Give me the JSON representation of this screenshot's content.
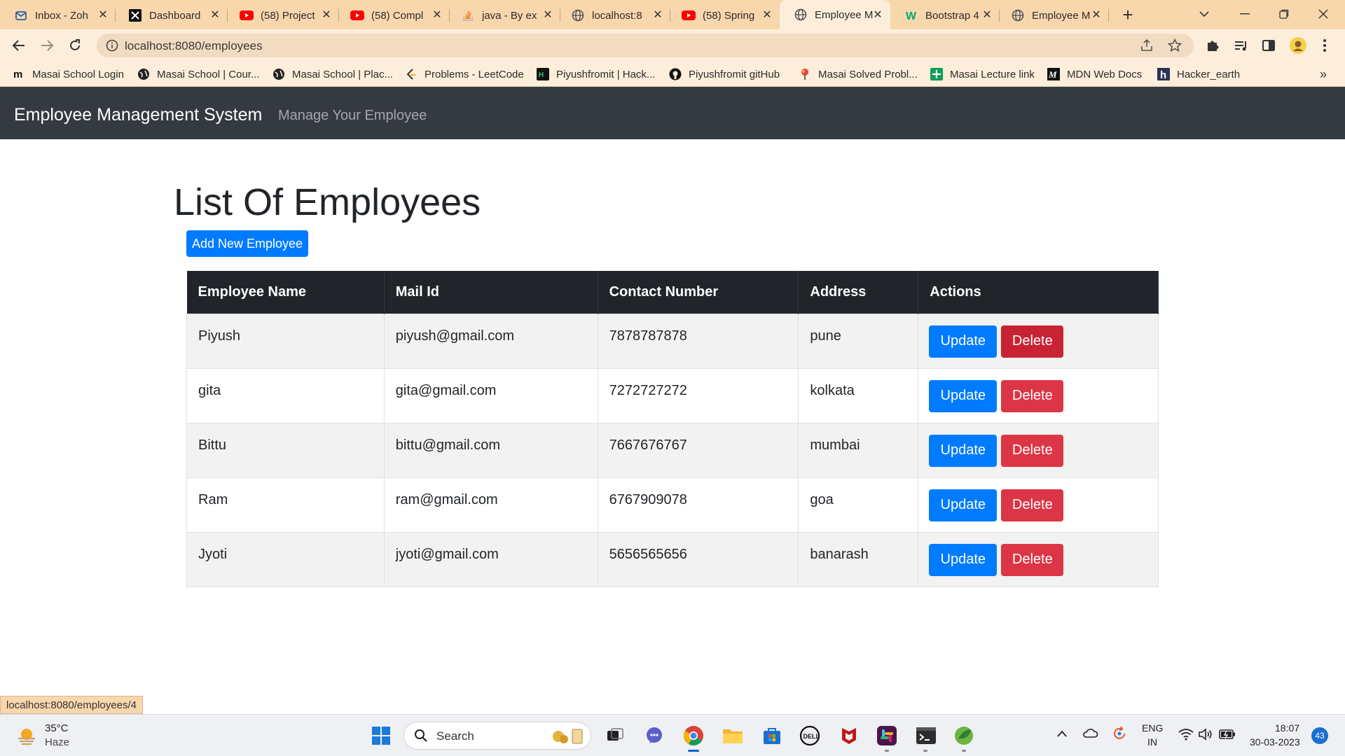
{
  "browser": {
    "tabs": [
      {
        "title": "Inbox - Zoh",
        "icon": "mail-icon"
      },
      {
        "title": "Dashboard",
        "icon": "x-logo-icon"
      },
      {
        "title": "(58) Project",
        "icon": "youtube-icon"
      },
      {
        "title": "(58) Compl",
        "icon": "youtube-icon"
      },
      {
        "title": "java - By ex",
        "icon": "stackoverflow-icon"
      },
      {
        "title": "localhost:8",
        "icon": "globe-icon"
      },
      {
        "title": "(58) Spring",
        "icon": "youtube-icon"
      },
      {
        "title": "Employee M",
        "icon": "globe-icon",
        "active": true
      },
      {
        "title": "Bootstrap 4",
        "icon": "w3schools-icon"
      },
      {
        "title": "Employee M",
        "icon": "globe-icon"
      }
    ],
    "url": "localhost:8080/employees",
    "bookmarks": [
      {
        "label": "Masai School Login",
        "icon": "masai-m-icon"
      },
      {
        "label": "Masai School | Cour...",
        "icon": "globe-icon"
      },
      {
        "label": "Masai School | Plac...",
        "icon": "globe-icon"
      },
      {
        "label": "Problems - LeetCode",
        "icon": "leetcode-icon"
      },
      {
        "label": "Piyushfromit | Hack...",
        "icon": "hackerrank-icon"
      },
      {
        "label": "Piyushfromit gitHub",
        "icon": "github-icon"
      },
      {
        "label": "Masai Solved Probl...",
        "icon": "pin-icon"
      },
      {
        "label": "Masai Lecture link",
        "icon": "plus-sheet-icon"
      },
      {
        "label": "MDN Web Docs",
        "icon": "mdn-icon"
      },
      {
        "label": "Hacker_earth",
        "icon": "hackerearth-icon"
      }
    ],
    "more_bookmarks": "»",
    "status_url": "localhost:8080/employees/4"
  },
  "app": {
    "brand": "Employee Management System",
    "nav_link": "Manage Your Employee",
    "heading": "List Of Employees",
    "add_button": "Add New Employee",
    "columns": [
      "Employee Name",
      "Mail Id",
      "Contact Number",
      "Address",
      "Actions"
    ],
    "rows": [
      {
        "name": "Piyush",
        "mail": "piyush@gmail.com",
        "contact": "7878787878",
        "address": "pune"
      },
      {
        "name": "gita",
        "mail": "gita@gmail.com",
        "contact": "7272727272",
        "address": "kolkata"
      },
      {
        "name": "Bittu",
        "mail": "bittu@gmail.com",
        "contact": "7667676767",
        "address": "mumbai"
      },
      {
        "name": "Ram",
        "mail": "ram@gmail.com",
        "contact": "6767909078",
        "address": "goa"
      },
      {
        "name": "Jyoti",
        "mail": "jyoti@gmail.com",
        "contact": "5656565656",
        "address": "banarash"
      }
    ],
    "update_label": "Update",
    "delete_label": "Delete",
    "colors": {
      "primary": "#007bff",
      "danger": "#dc3545",
      "navbar": "#343a40",
      "table_head": "#212529"
    }
  },
  "taskbar": {
    "weather_temp": "35°C",
    "weather_desc": "Haze",
    "search_label": "Search",
    "lang_top": "ENG",
    "lang_bottom": "IN",
    "time": "18:07",
    "date": "30-03-2023",
    "notification_count": "43"
  }
}
